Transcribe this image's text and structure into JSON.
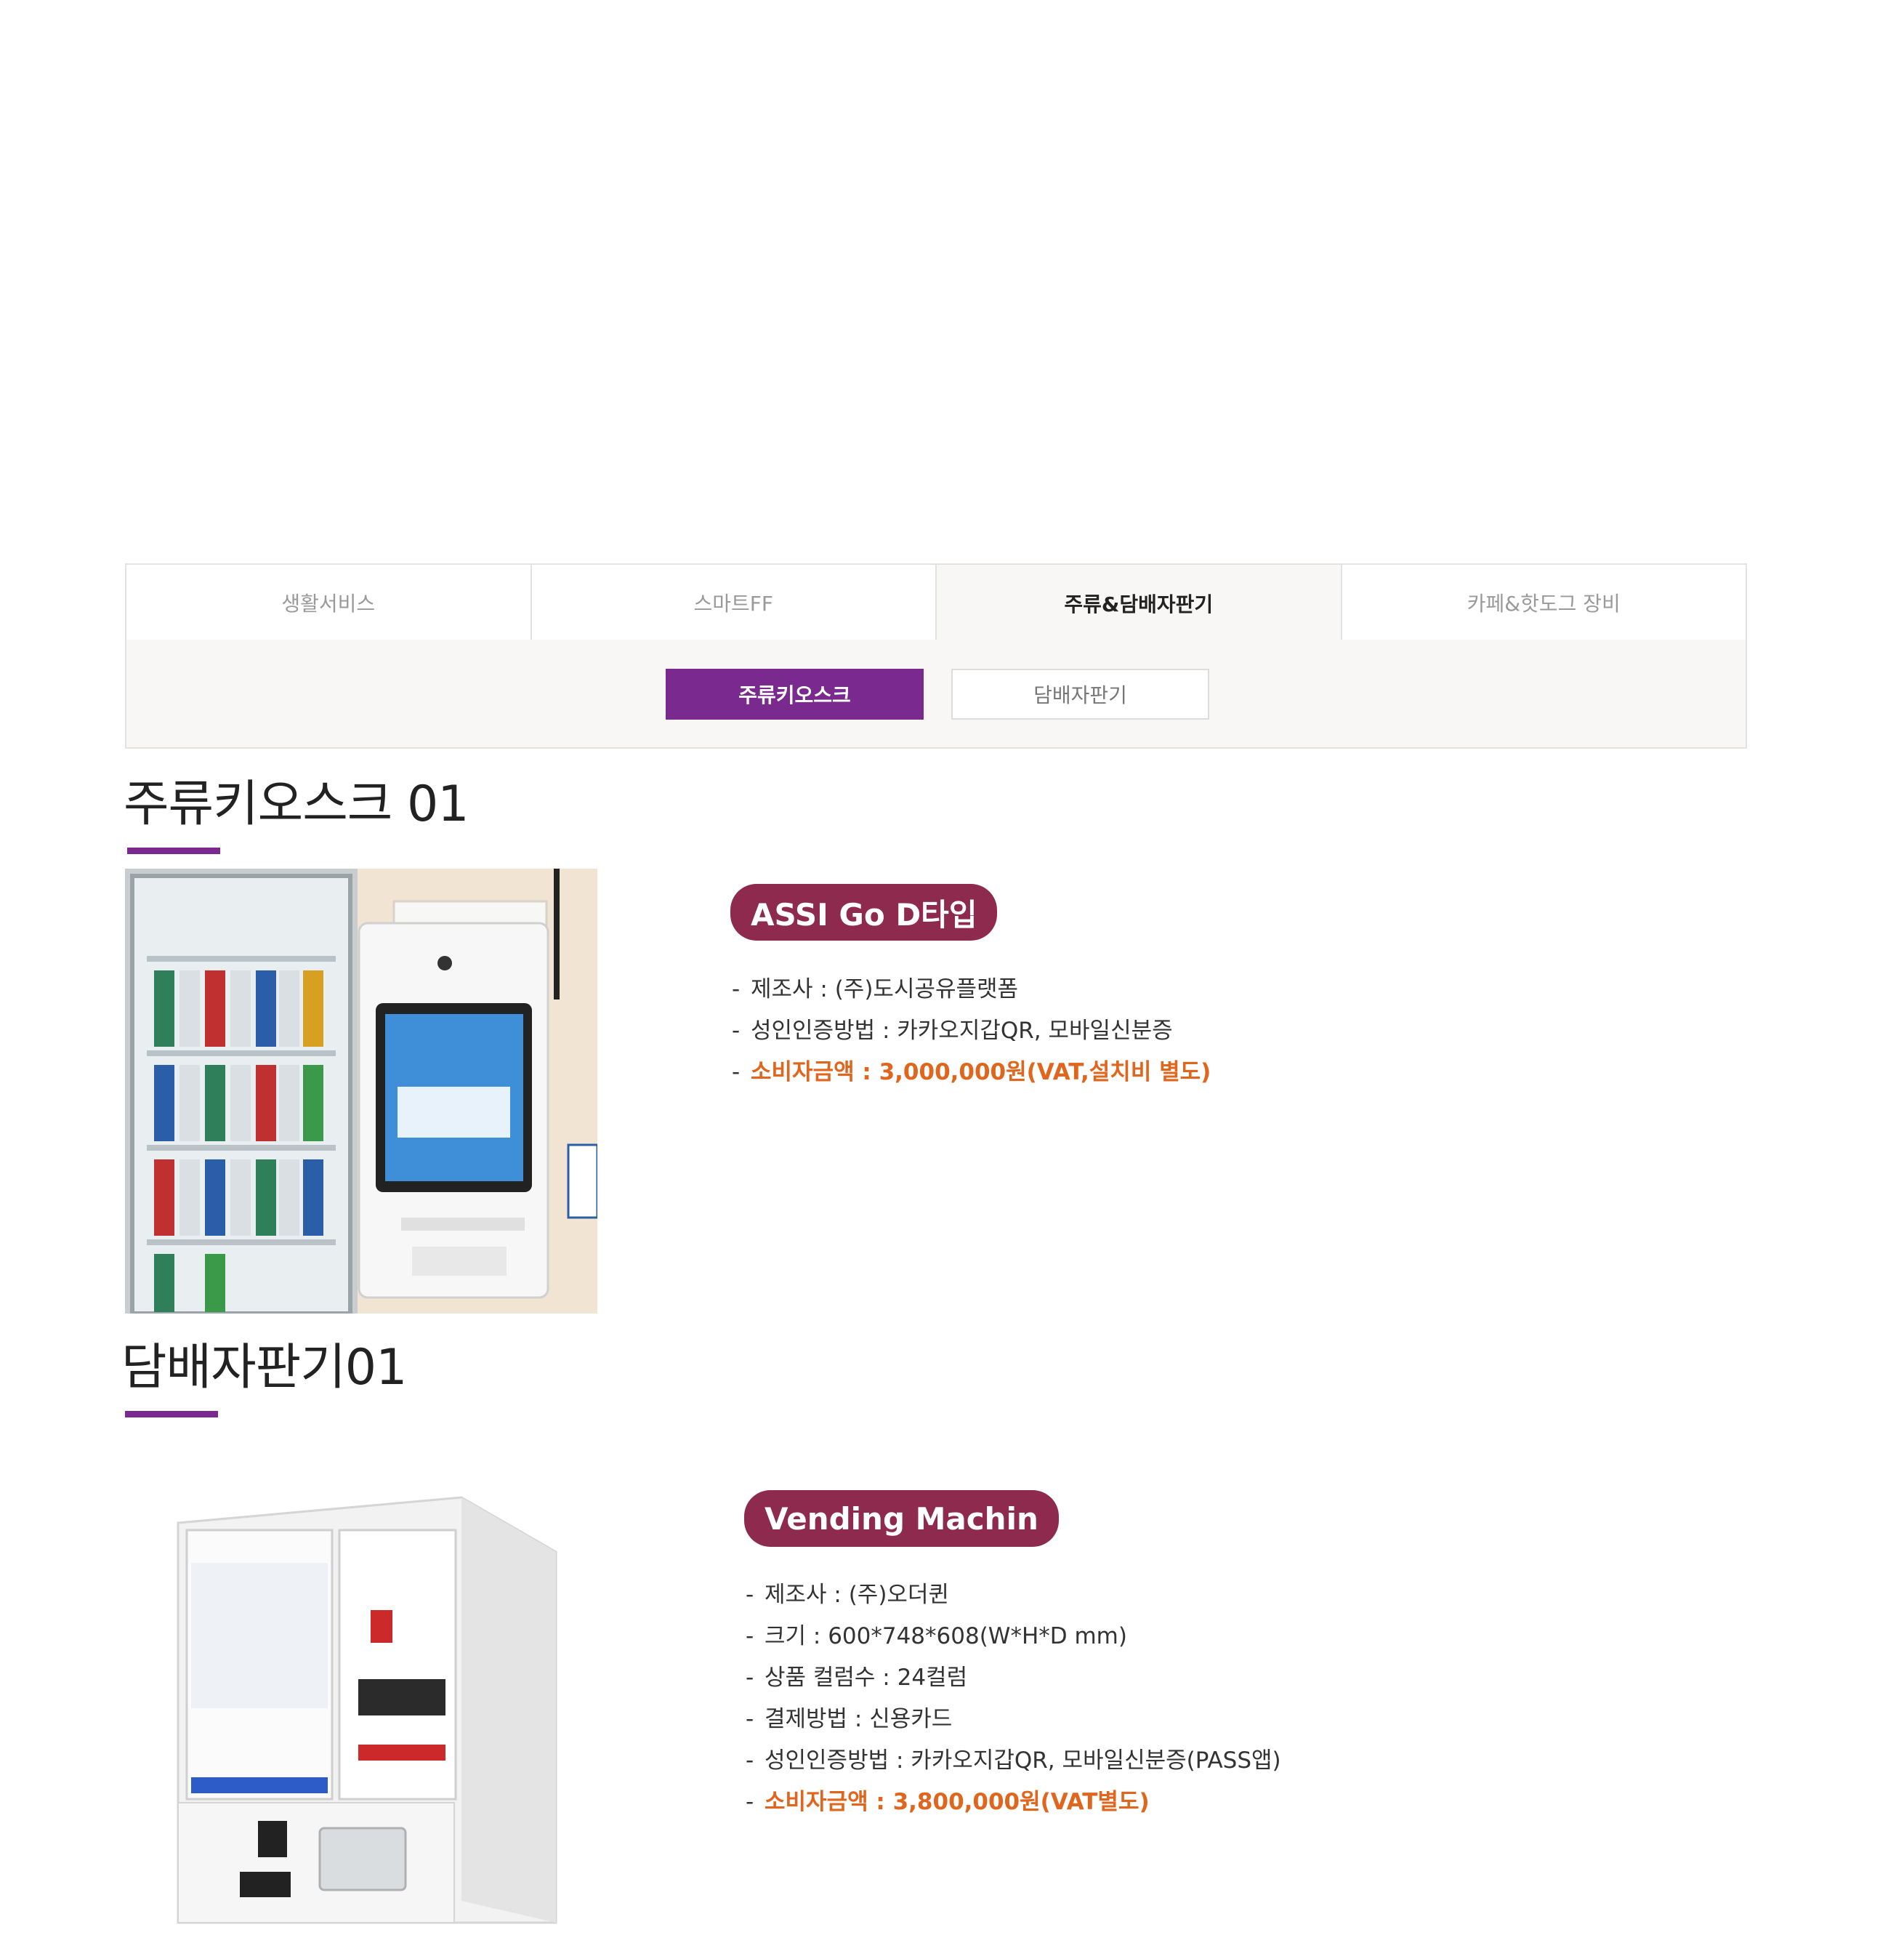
{
  "category_tabs": [
    {
      "label": "생활서비스",
      "active": false
    },
    {
      "label": "스마트FF",
      "active": false
    },
    {
      "label": "주류&담배자판기",
      "active": true
    },
    {
      "label": "카페&핫도그 장비",
      "active": false
    }
  ],
  "sub_tabs": [
    {
      "label": "주류키오스크",
      "active": true
    },
    {
      "label": "담배자판기",
      "active": false
    }
  ],
  "sections": [
    {
      "title": "주류키오스크 01",
      "product_name": "ASSI Go D타입",
      "specs": [
        "제조사 : (주)도시공유플랫폼",
        "성인인증방법 : 카카오지갑QR, 모바일신분증"
      ],
      "price": "소비자금액 : 3,000,000원(VAT,설치비 별도)"
    },
    {
      "title": "담배자판기01",
      "product_name": "Vending Machin",
      "specs": [
        "제조사 : (주)오더퀸",
        "크기 : 600*748*608(W*H*D mm)",
        "상품 컬럼수 : 24컬럼",
        "결제방법 : 신용카드",
        "성인인증방법 : 카카오지갑QR, 모바일신분증(PASS앱)"
      ],
      "price": "소비자금액 : 3,800,000원(VAT별도)"
    }
  ],
  "colors": {
    "accent_purple": "#7a2a8e",
    "pill_maroon": "#8e2a4d",
    "price_orange": "#e0651d"
  }
}
